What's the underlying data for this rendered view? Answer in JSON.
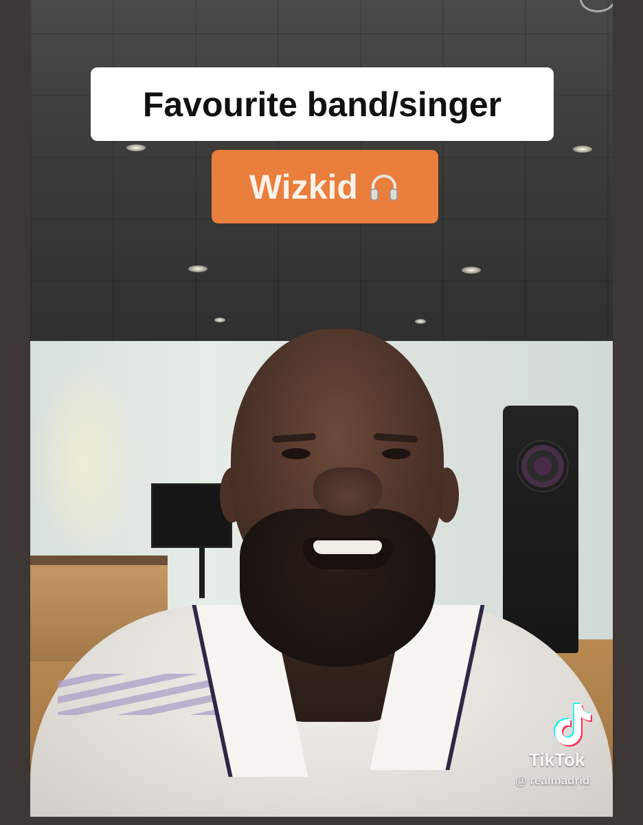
{
  "caption": {
    "title": "Favourite band/singer",
    "answer": "Wizkid",
    "answer_icon": "headphone-icon"
  },
  "watermark": {
    "brand": "TikTok",
    "handle": "@ realmadrid"
  },
  "colors": {
    "frame_border": "#3d3735",
    "answer_background": "#e97e3d",
    "title_background": "#ffffff"
  }
}
